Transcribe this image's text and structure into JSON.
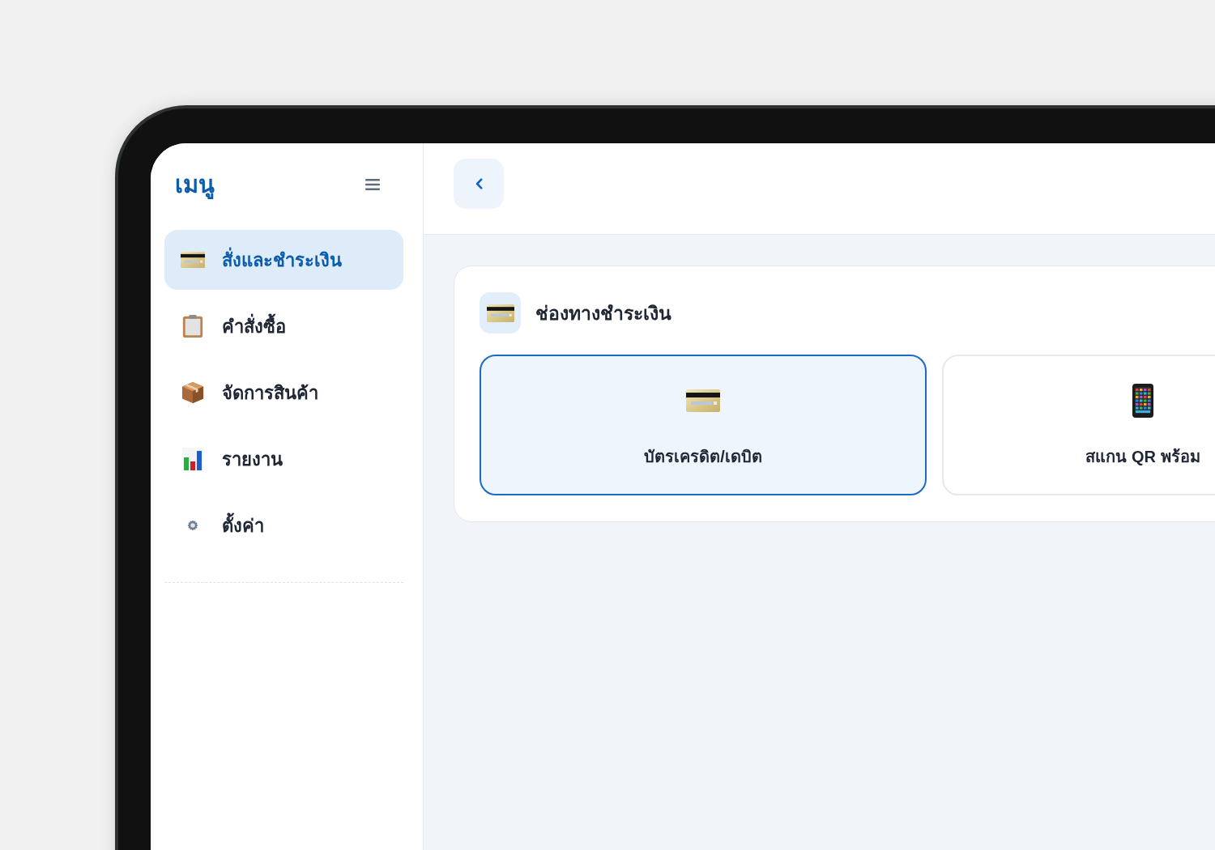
{
  "sidebar": {
    "title": "เมนู",
    "items": [
      {
        "label": "สั่งและชำระเงิน",
        "selected": true,
        "kind": "payment"
      },
      {
        "label": "คำสั่งซื้อ",
        "selected": false,
        "kind": "orders"
      },
      {
        "label": "จัดการสินค้า",
        "selected": false,
        "kind": "products"
      },
      {
        "label": "รายงาน",
        "selected": false,
        "kind": "reports"
      },
      {
        "label": "ตั้งค่า",
        "selected": false,
        "kind": "settings"
      }
    ]
  },
  "payment_panel": {
    "title": "ช่องทางชำระเงิน",
    "options": [
      {
        "label": "บัตรเครดิต/เดบิต",
        "selected": true,
        "kind": "card"
      },
      {
        "label": "สแกน QR พร้อม",
        "selected": false,
        "kind": "phone"
      }
    ]
  }
}
